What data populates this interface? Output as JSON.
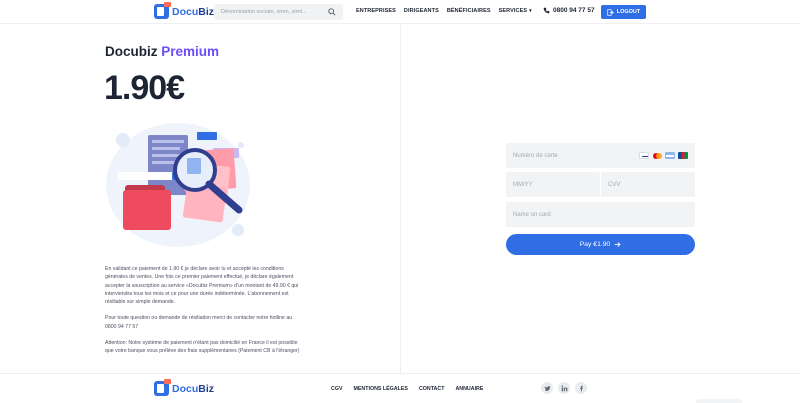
{
  "header": {
    "logo_text_a": "Docu",
    "logo_text_b": "Biz",
    "search_placeholder": "Dénomination sociale, siren, siret...",
    "nav": [
      {
        "label": "ENTREPRISES"
      },
      {
        "label": "DIRIGEANTS"
      },
      {
        "label": "BÉNÉFICIAIRES"
      },
      {
        "label": "SERVICES"
      }
    ],
    "phone": "0800 94 77 57",
    "logout_label": "LOGOUT"
  },
  "plan": {
    "title_a": "Docubiz",
    "title_b": "Premium",
    "price": "1.90€"
  },
  "legal": {
    "p1": "En validant ce paiement de 1.90 € je déclare avoir lu et accepté les conditions générales de ventes. Une fois ce premier paiement effectué, je déclare également accepter la souscription au service «Docubiz Premium» d'un montant de 49.90 € qui interviendra tous les mois et ce pour une durée indéterminée. L'abonnement est résiliable sur simple demande.",
    "p2": "Pour toute question ou demande de résiliation merci de contacter notre hotline au 0800 94 77 57",
    "p3": "Attention: Notre système de paiement n'étant pas domicilié en France il est possible que votre banque vous prélève des frais supplémentaires (Paiement CB à l'étranger)"
  },
  "payment": {
    "card_placeholder": "Numéro de carte",
    "expiry_placeholder": "MM/YY",
    "cvv_placeholder": "CVV",
    "name_placeholder": "Name on card",
    "pay_label": "Pay €1.90",
    "brands": [
      "visa-icon",
      "mastercard-icon",
      "amex-icon",
      "jcb-icon"
    ]
  },
  "footer": {
    "logo_text_a": "Docu",
    "logo_text_b": "Biz",
    "links": [
      {
        "label": "CGV"
      },
      {
        "label": "MENTIONS LÉGALES"
      },
      {
        "label": "CONTACT"
      },
      {
        "label": "ANNUAIRE"
      }
    ],
    "socials": [
      "twitter-icon",
      "linkedin-icon",
      "facebook-icon"
    ]
  },
  "colors": {
    "primary": "#2f6ee5",
    "accent": "#6c4df6",
    "text": "#1d2433",
    "field_bg": "#f2f3f5"
  }
}
